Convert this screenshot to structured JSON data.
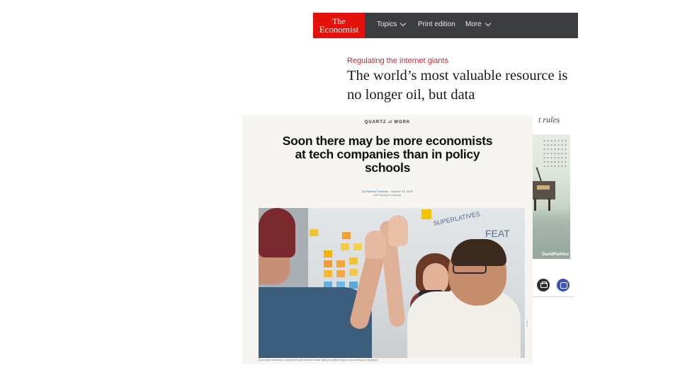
{
  "economist": {
    "logo_line1": "The",
    "logo_line2": "Economist",
    "nav": {
      "topics": "Topics",
      "print_edition": "Print edition",
      "more": "More"
    },
    "flytitle": "Regulating the internet giants",
    "headline": "The world’s most valuable resource is no longer oil, but data",
    "rubric": "t rules",
    "image_credit": "DavidParkins",
    "colors": {
      "brand_red": "#e3120b",
      "nav_bg": "#3b3d40",
      "flytitle": "#c9272f"
    },
    "icons": [
      "print-icon",
      "comment-icon"
    ]
  },
  "quartz": {
    "section_prefix": "QUARTZ",
    "section_at": "at",
    "section_suffix": "WORK",
    "headline": "Soon there may be more economists at tech companies than in policy schools",
    "byline_prefix": "By",
    "author": "Roberto Ferdman",
    "date": "October 15, 2016",
    "partner": "HBS Working Knowledge",
    "photo_caption": "Economists worldwide: at least here just between similar staff perceptible impact in the workspace ([a] direct)",
    "photo_credit": "Reuters",
    "whiteboard_text_1": "SUPERLATIVES",
    "whiteboard_text_2": "FEAT"
  }
}
